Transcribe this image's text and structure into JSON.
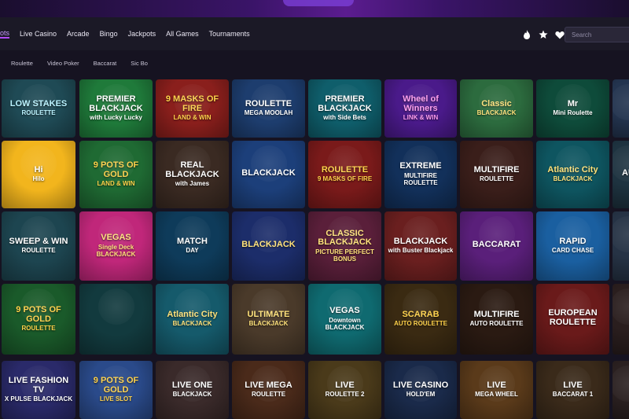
{
  "nav": {
    "items": [
      "ots",
      "Live Casino",
      "Arcade",
      "Bingo",
      "Jackpots",
      "All Games",
      "Tournaments"
    ]
  },
  "search": {
    "placeholder": "Search"
  },
  "icons": [
    "flame-icon",
    "star-icon",
    "heart-icon"
  ],
  "subnav": {
    "items": [
      "Roulette",
      "Video Poker",
      "Baccarat",
      "Sic Bo"
    ]
  },
  "tiles": [
    [
      {
        "t1": "LOW STAKES",
        "t2": "ROULETTE",
        "bg": "#1f4a55",
        "fg": "#b9f3ff"
      },
      {
        "t1": "PREMIER BLACKJACK",
        "t2": "with Lucky Lucky",
        "bg": "#1f7a3a",
        "fg": "#ffffff"
      },
      {
        "t1": "9 MASKS OF FIRE",
        "t2": "LAND & WIN",
        "bg": "#8a1f1c",
        "fg": "#ffd24a"
      },
      {
        "t1": "ROULETTE",
        "t2": "MEGA MOOLAH",
        "bg": "#1d3d6e",
        "fg": "#ffffff"
      },
      {
        "t1": "PREMIER BLACKJACK",
        "t2": "with Side Bets",
        "bg": "#0f5e6b",
        "fg": "#ffffff"
      },
      {
        "t1": "Wheel of Winners",
        "t2": "LINK & WIN",
        "bg": "#4a1a8a",
        "fg": "#ff9bf0"
      },
      {
        "t1": "Classic",
        "t2": "BLACKJACK",
        "bg": "#2c6b3e",
        "fg": "#ffe27a"
      },
      {
        "t1": "Mr",
        "t2": "Mini Roulette",
        "bg": "#0e4b3a",
        "fg": "#ffffff"
      },
      {
        "t1": "",
        "t2": "",
        "bg": "#23344f",
        "fg": "#ffffff"
      }
    ],
    [
      {
        "t1": "Hi",
        "t2": "Hilo",
        "bg": "#f2b51d",
        "fg": "#ffffff"
      },
      {
        "t1": "9 POTS OF GOLD",
        "t2": "LAND & WIN",
        "bg": "#1f6a33",
        "fg": "#ffd24a"
      },
      {
        "t1": "REAL BLACKJACK",
        "t2": "with James",
        "bg": "#3a2a22",
        "fg": "#ffffff"
      },
      {
        "t1": "BLACKJACK",
        "t2": "",
        "bg": "#1c3f7a",
        "fg": "#ffffff"
      },
      {
        "t1": "ROULETTE",
        "t2": "9 MASKS OF FIRE",
        "bg": "#7a1a1a",
        "fg": "#ffd24a"
      },
      {
        "t1": "EXTREME",
        "t2": "MULTIFIRE ROULETTE",
        "bg": "#12305a",
        "fg": "#ffffff"
      },
      {
        "t1": "MULTIFIRE",
        "t2": "ROULETTE",
        "bg": "#3a1e1a",
        "fg": "#ffffff"
      },
      {
        "t1": "Atlantic City",
        "t2": "BLACKJACK",
        "bg": "#0e5560",
        "fg": "#ffe27a"
      },
      {
        "t1": "AU",
        "t2": "",
        "bg": "#1e3340",
        "fg": "#ffffff"
      }
    ],
    [
      {
        "t1": "SWEEP & WIN",
        "t2": "ROULETTE",
        "bg": "#1d4550",
        "fg": "#ffffff"
      },
      {
        "t1": "VEGAS",
        "t2": "Single Deck BLACKJACK",
        "bg": "#c0277a",
        "fg": "#ffe27a"
      },
      {
        "t1": "MATCH",
        "t2": "DAY",
        "bg": "#0e3b5a",
        "fg": "#ffffff"
      },
      {
        "t1": "BLACKJACK",
        "t2": "",
        "bg": "#1c2d6a",
        "fg": "#ffe27a"
      },
      {
        "t1": "CLASSIC BLACKJACK",
        "t2": "PICTURE PERFECT BONUS",
        "bg": "#5a1f3a",
        "fg": "#ffe27a"
      },
      {
        "t1": "BLACKJACK",
        "t2": "with Buster Blackjack",
        "bg": "#6a1f1f",
        "fg": "#ffffff"
      },
      {
        "t1": "BACCARAT",
        "t2": "",
        "bg": "#5a1f7a",
        "fg": "#ffffff"
      },
      {
        "t1": "RAPID",
        "t2": "CARD CHASE",
        "bg": "#1a5fa0",
        "fg": "#ffffff"
      },
      {
        "t1": "",
        "t2": "",
        "bg": "#263345",
        "fg": "#ffffff"
      }
    ],
    [
      {
        "t1": "9 POTS OF GOLD",
        "t2": "ROULETTE",
        "bg": "#1a5a2a",
        "fg": "#ffd24a"
      },
      {
        "t1": "",
        "t2": "",
        "bg": "#123a3e",
        "fg": "#ffffff"
      },
      {
        "t1": "Atlantic City",
        "t2": "BLACKJACK",
        "bg": "#155a6b",
        "fg": "#ffe27a"
      },
      {
        "t1": "ULTIMATE",
        "t2": "BLACKJACK",
        "bg": "#4a3a2a",
        "fg": "#ffe27a"
      },
      {
        "t1": "VEGAS",
        "t2": "Downtown BLACKJACK",
        "bg": "#0f6a70",
        "fg": "#ffffff"
      },
      {
        "t1": "SCARAB",
        "t2": "AUTO ROULETTE",
        "bg": "#3a2a12",
        "fg": "#ffd24a"
      },
      {
        "t1": "MULTIFIRE",
        "t2": "AUTO ROULETTE",
        "bg": "#2a1a12",
        "fg": "#ffffff"
      },
      {
        "t1": "EUROPEAN ROULETTE",
        "t2": "",
        "bg": "#6a1a1a",
        "fg": "#ffffff"
      },
      {
        "t1": "",
        "t2": "",
        "bg": "#2a1e1e",
        "fg": "#ffffff"
      }
    ],
    [
      {
        "t1": "LIVE FASHION TV",
        "t2": "X PULSE BLACKJACK",
        "bg": "#2a2a6a",
        "fg": "#ffffff"
      },
      {
        "t1": "9 POTS OF GOLD",
        "t2": "LIVE SLOT",
        "bg": "#2a4a8a",
        "fg": "#ffd24a"
      },
      {
        "t1": "LIVE ONE",
        "t2": "BLACKJACK",
        "bg": "#3a2a2a",
        "fg": "#ffffff"
      },
      {
        "t1": "LIVE MEGA",
        "t2": "ROULETTE",
        "bg": "#4a2a1a",
        "fg": "#ffffff"
      },
      {
        "t1": "LIVE",
        "t2": "ROULETTE 2",
        "bg": "#4a3a1a",
        "fg": "#ffffff"
      },
      {
        "t1": "LIVE CASINO",
        "t2": "HOLD'EM",
        "bg": "#1a2a4a",
        "fg": "#ffffff"
      },
      {
        "t1": "LIVE",
        "t2": "MEGA WHEEL",
        "bg": "#5a3a1a",
        "fg": "#ffffff"
      },
      {
        "t1": "LIVE",
        "t2": "BACCARAT 1",
        "bg": "#3a2a1a",
        "fg": "#ffffff"
      },
      {
        "t1": "",
        "t2": "",
        "bg": "#2a2020",
        "fg": "#ffffff"
      }
    ]
  ]
}
